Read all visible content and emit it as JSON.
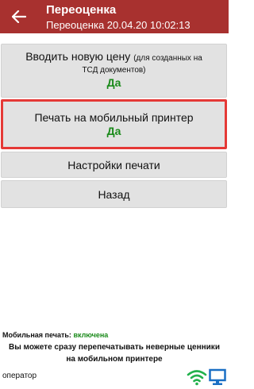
{
  "header": {
    "title": "Переоценка",
    "subtitle": "Переоценка 20.04.20 10:02:13"
  },
  "menu": {
    "enter_price": {
      "label": "Вводить новую цену",
      "note_line1": "(для созданных на",
      "note_line2": "ТСД документов)",
      "value": "Да"
    },
    "mobile_print": {
      "label": "Печать на мобильный принтер",
      "value": "Да"
    },
    "print_settings": {
      "label": "Настройки печати"
    },
    "back": {
      "label": "Назад"
    }
  },
  "footer": {
    "status_label": "Мобильная печать:",
    "status_value": "включена",
    "notice_line1": "Вы можете сразу перепечатывать неверные ценники",
    "notice_line2": "на мобильном принтере",
    "user": "оператор"
  },
  "colors": {
    "appbar": "#a8312f",
    "highlight": "#e53936",
    "value_green": "#1a8a1a",
    "wifi_icon": "#22b14c",
    "monitor_icon": "#1a6fc4"
  },
  "icons": {
    "back": "arrow-left-icon",
    "wifi": "wifi-icon",
    "monitor": "monitor-icon"
  }
}
